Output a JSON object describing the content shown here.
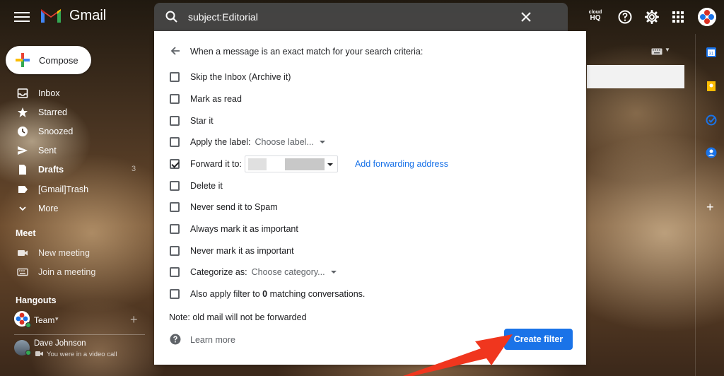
{
  "app": {
    "name": "Gmail"
  },
  "search": {
    "query": "subject:Editorial"
  },
  "topbar": {
    "hq_line1": "cloud",
    "hq_line2": "HQ"
  },
  "compose": {
    "label": "Compose"
  },
  "nav": {
    "items": [
      {
        "label": "Inbox",
        "icon": "inbox-icon"
      },
      {
        "label": "Starred",
        "icon": "star-icon"
      },
      {
        "label": "Snoozed",
        "icon": "clock-icon"
      },
      {
        "label": "Sent",
        "icon": "send-icon"
      },
      {
        "label": "Drafts",
        "icon": "draft-icon",
        "count": "3"
      },
      {
        "label": "[Gmail]Trash",
        "icon": "label-icon"
      },
      {
        "label": "More",
        "icon": "chevron-down-icon"
      }
    ]
  },
  "meet": {
    "title": "Meet",
    "new_meeting": "New meeting",
    "join_meeting": "Join a meeting"
  },
  "hangouts": {
    "title": "Hangouts",
    "team_label": "Team",
    "team_caret": "▾",
    "add": "+",
    "user_name": "Dave Johnson",
    "user_status": "You were in a video call"
  },
  "filter": {
    "heading": "When a message is an exact match for your search criteria:",
    "options": {
      "skip_inbox": "Skip the Inbox (Archive it)",
      "mark_read": "Mark as read",
      "star_it": "Star it",
      "apply_label": "Apply the label:",
      "choose_label": "Choose label...",
      "forward_to": "Forward it to:",
      "add_forwarding": "Add forwarding address",
      "delete_it": "Delete it",
      "never_spam": "Never send it to Spam",
      "always_important": "Always mark it as important",
      "never_important": "Never mark it as important",
      "categorize_as": "Categorize as:",
      "choose_category": "Choose category...",
      "also_apply_pre": "Also apply filter to",
      "also_apply_count": "0",
      "also_apply_post": "matching conversations."
    },
    "checked": {
      "forward_to": true
    },
    "note": "Note: old mail will not be forwarded",
    "learn_more": "Learn more",
    "create_filter": "Create filter"
  },
  "right_panel": {
    "add": "+"
  },
  "colors": {
    "primary_blue": "#1a73e8",
    "annotation_arrow": "#f0361e"
  }
}
